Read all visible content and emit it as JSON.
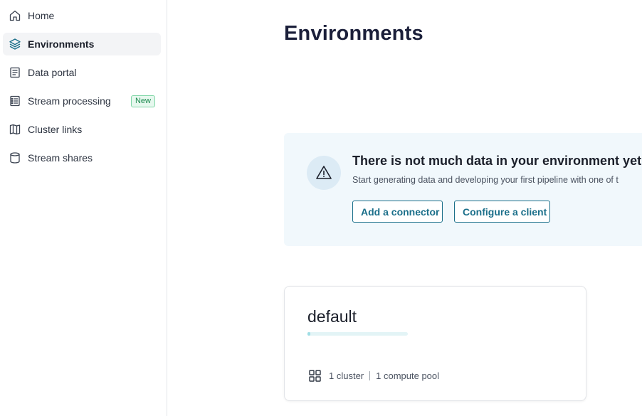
{
  "sidebar": {
    "items": [
      {
        "label": "Home",
        "icon": "home-icon"
      },
      {
        "label": "Environments",
        "icon": "layers-icon",
        "active": true
      },
      {
        "label": "Data portal",
        "icon": "document-icon"
      },
      {
        "label": "Stream processing",
        "icon": "list-icon",
        "badge": "New"
      },
      {
        "label": "Cluster links",
        "icon": "map-icon"
      },
      {
        "label": "Stream shares",
        "icon": "cylinder-icon"
      }
    ]
  },
  "main": {
    "title": "Environments",
    "banner": {
      "title": "There is not much data in your environment yet",
      "subtitle": "Start generating data and developing your first pipeline with one of t",
      "add_connector_label": "Add a connector",
      "configure_client_label": "Configure a client"
    },
    "environment_card": {
      "name": "default",
      "clusters": "1 cluster",
      "compute_pools": "1 compute pool"
    }
  },
  "colors": {
    "accent": "#1b6f8a",
    "banner_bg": "#f1f8fc",
    "badge_green": "#1c8a4f",
    "active_nav_bg": "#f3f4f6"
  }
}
